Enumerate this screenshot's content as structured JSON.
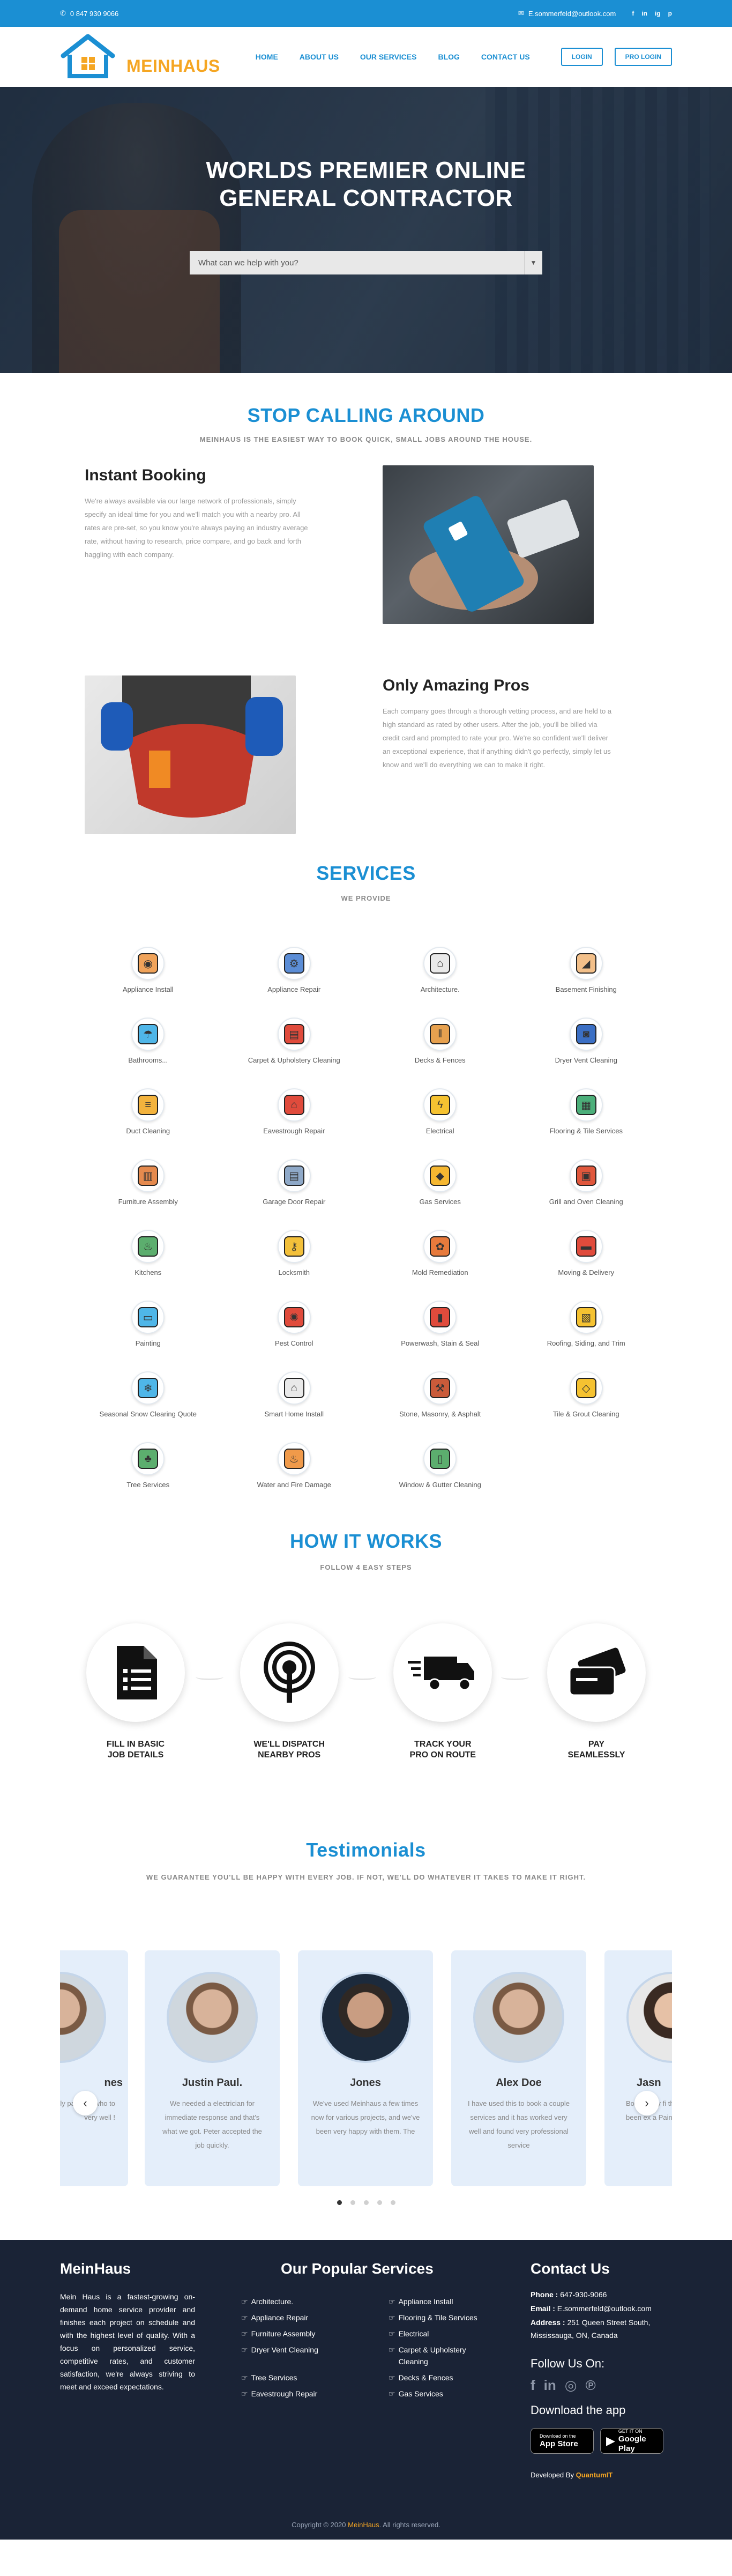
{
  "topbar": {
    "phone": "0 847 930 9066",
    "email": "E.sommerfeld@outlook.com",
    "social": [
      "f",
      "in",
      "ig",
      "p"
    ]
  },
  "header": {
    "logo_text": "MEINHAUS",
    "nav": [
      "HOME",
      "ABOUT US",
      "OUR SERVICES",
      "BLOG",
      "CONTACT US"
    ],
    "login": "LOGIN",
    "pro_login": "PRO LOGIN"
  },
  "hero": {
    "title_line1": "WORLDS PREMIER ONLINE",
    "title_line2": "GENERAL CONTRACTOR",
    "search_placeholder": "What can we help with you?"
  },
  "stop": {
    "title": "STOP CALLING AROUND",
    "subtitle": "MEINHAUS IS THE EASIEST WAY TO BOOK QUICK, SMALL JOBS AROUND THE HOUSE.",
    "instant_title": "Instant Booking",
    "instant_text": "We're always available via our large network of professionals, simply specify an ideal time for you and we'll match you with a nearby pro. All rates are pre-set, so you know you're always paying an industry average rate, without having to research, price compare, and go back and forth haggling with each company.",
    "pros_title": "Only Amazing Pros",
    "pros_text": "Each company goes through a thorough vetting process, and are held to a high standard as rated by other users. After the job, you'll be billed via credit card and prompted to rate your pro. We're so confident we'll deliver an exceptional experience, that if anything didn't go perfectly, simply let us know and we'll do everything we can to make it right."
  },
  "services": {
    "title": "SERVICES",
    "subtitle": "WE PROVIDE",
    "items": [
      {
        "label": "Appliance Install",
        "icon": "washer-icon",
        "color": "#f0a35a"
      },
      {
        "label": "Appliance Repair",
        "icon": "appliance-repair-icon",
        "color": "#5b8dd6"
      },
      {
        "label": "Architecture.",
        "icon": "house-blueprint-icon",
        "color": "#e9e9e9"
      },
      {
        "label": "Basement Finishing",
        "icon": "stairs-icon",
        "color": "#f3c08a"
      },
      {
        "label": "Bathrooms...",
        "icon": "shower-icon",
        "color": "#4fb6e8"
      },
      {
        "label": "Carpet & Upholstery Cleaning",
        "icon": "carpet-icon",
        "color": "#e04b3c"
      },
      {
        "label": "Decks & Fences",
        "icon": "fence-icon",
        "color": "#e7a14f"
      },
      {
        "label": "Dryer Vent Cleaning",
        "icon": "dryer-icon",
        "color": "#3b6fc4"
      },
      {
        "label": "Duct Cleaning",
        "icon": "air-duct-icon",
        "color": "#f3b33d"
      },
      {
        "label": "Eavestrough Repair",
        "icon": "roof-gutter-icon",
        "color": "#e04b3c"
      },
      {
        "label": "Electrical",
        "icon": "lightning-icon",
        "color": "#f5c231"
      },
      {
        "label": "Flooring & Tile Services",
        "icon": "tiles-icon",
        "color": "#4caf7a"
      },
      {
        "label": "Furniture Assembly",
        "icon": "cabinet-icon",
        "color": "#e58a4e"
      },
      {
        "label": "Garage Door Repair",
        "icon": "garage-door-icon",
        "color": "#8fa9c8"
      },
      {
        "label": "Gas Services",
        "icon": "gas-tank-icon",
        "color": "#f5b731"
      },
      {
        "label": "Grill and Oven Cleaning",
        "icon": "oven-icon",
        "color": "#e0573c"
      },
      {
        "label": "Kitchens",
        "icon": "kitchen-icon",
        "color": "#5cae6e"
      },
      {
        "label": "Locksmith",
        "icon": "key-icon",
        "color": "#f3c03a"
      },
      {
        "label": "Mold Remediation",
        "icon": "mold-icon",
        "color": "#e77a3c"
      },
      {
        "label": "Moving & Delivery",
        "icon": "truck-icon",
        "color": "#e04b3c"
      },
      {
        "label": "Painting",
        "icon": "paint-roller-icon",
        "color": "#4fb6e8"
      },
      {
        "label": "Pest Control",
        "icon": "bug-icon",
        "color": "#e04b3c"
      },
      {
        "label": "Powerwash, Stain & Seal",
        "icon": "spray-bottle-icon",
        "color": "#e04b3c"
      },
      {
        "label": "Roofing, Siding, and Trim",
        "icon": "map-icon",
        "color": "#f5c231"
      },
      {
        "label": "Seasonal Snow Clearing Quote",
        "icon": "snowflake-icon",
        "color": "#4fb6e8"
      },
      {
        "label": "Smart Home Install",
        "icon": "smart-home-icon",
        "color": "#e9e9e9"
      },
      {
        "label": "Stone, Masonry, & Asphalt",
        "icon": "shovel-icon",
        "color": "#c95b3a"
      },
      {
        "label": "Tile & Grout Cleaning",
        "icon": "tile-clean-icon",
        "color": "#f5c231"
      },
      {
        "label": "Tree Services",
        "icon": "tree-icon",
        "color": "#5cae6e"
      },
      {
        "label": "Water and Fire Damage",
        "icon": "water-fire-icon",
        "color": "#f09a4a"
      },
      {
        "label": "Window & Gutter Cleaning",
        "icon": "window-icon",
        "color": "#5cae6e"
      }
    ]
  },
  "how": {
    "title": "HOW IT WORKS",
    "subtitle": "FOLLOW 4 EASY STEPS",
    "steps": [
      {
        "line1": "FILL IN BASIC",
        "line2": "JOB DETAILS",
        "icon": "document-icon"
      },
      {
        "line1": "WE'LL DISPATCH",
        "line2": "NEARBY PROS",
        "icon": "broadcast-icon"
      },
      {
        "line1": "TRACK YOUR",
        "line2": "PRO ON ROUTE",
        "icon": "delivery-truck-icon"
      },
      {
        "line1": "PAY",
        "line2": "SEAMLESSLY",
        "icon": "credit-card-icon"
      }
    ]
  },
  "testimonials": {
    "title": "Testimonials",
    "subtitle": "WE GUARANTEE YOU'LL BE HAPPY WITH EVERY JOB. IF NOT, WE'LL DO WHATEVER IT TAKES TO MAKE IT RIGHT.",
    "cards": [
      {
        "name": "nes",
        "text": "mpt and ers, highly partners who to very well !"
      },
      {
        "name": "Justin Paul.",
        "text": "We needed a electrician for immediate response and that's what we got. Peter accepted the job quickly."
      },
      {
        "name": "Jones",
        "text": "We've used Meinhaus a few times now for various projects, and we've been very happy with them. The"
      },
      {
        "name": "Alex Doe",
        "text": "I have used this to book a couple services and it has worked very well and found very professional service"
      },
      {
        "name": "Jasn",
        "text": "Booked my fi this week, an have been ex a Painter"
      }
    ],
    "prev": "‹",
    "next": "›"
  },
  "footer": {
    "brand": "MeinHaus",
    "about": "Mein Haus is a fastest-growing on-demand home service provider and finishes each project on schedule and with the highest level of quality. With a focus on personalized service, competitive rates, and customer satisfaction, we're always striving to meet and exceed expectations.",
    "popular_title": "Our Popular Services",
    "popular_left": [
      "Architecture.",
      "Appliance Repair",
      "Furniture Assembly",
      "Dryer Vent Cleaning",
      "Tree Services",
      "Eavestrough Repair"
    ],
    "popular_right": [
      "Appliance Install",
      "Flooring & Tile Services",
      "Electrical",
      "Carpet & Upholstery Cleaning",
      "Decks & Fences",
      "Gas Services"
    ],
    "contact_title": "Contact Us",
    "phone_label": "Phone :",
    "phone": "647-930-9066",
    "email_label": "Email :",
    "email": "E.sommerfeld@outlook.com",
    "address_label": "Address :",
    "address": "251 Queen Street South, Mississauga, ON, Canada",
    "follow": "Follow Us On:",
    "download": "Download the app",
    "appstore_small": "Download on the",
    "appstore": "App Store",
    "play_small": "GET IT ON",
    "play": "Google Play",
    "developed_by": "Developed By",
    "developer": "QuantumIT",
    "copyright_pre": "Copyright © 2020",
    "copyright_brand": "MeinHaus",
    "copyright_post": ". All rights reserved."
  }
}
